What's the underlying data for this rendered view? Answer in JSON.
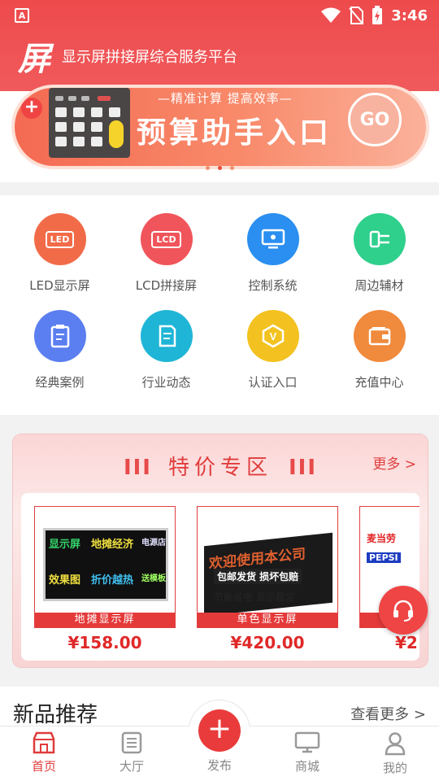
{
  "status_bar": {
    "app_badge": "A",
    "time": "3:46"
  },
  "header": {
    "logo_text": "屏",
    "platform_title": "显示屏拼接屏综合服务平台"
  },
  "banner": {
    "subtitle": "—精准计算 提高效率—",
    "title": "预算助手入口",
    "go_label": "GO",
    "plus": "+"
  },
  "categories": [
    {
      "label": "LED显示屏",
      "icon_text": "LED",
      "color": "#f26b48"
    },
    {
      "label": "LCD拼接屏",
      "icon_text": "LCD",
      "color": "#f0555b"
    },
    {
      "label": "控制系统",
      "icon_text": "",
      "color": "#2a8ff0"
    },
    {
      "label": "周边辅材",
      "icon_text": "",
      "color": "#2fcf8c"
    },
    {
      "label": "经典案例",
      "icon_text": "",
      "color": "#5b7ff0"
    },
    {
      "label": "行业动态",
      "icon_text": "",
      "color": "#1fb5d6"
    },
    {
      "label": "认证入口",
      "icon_text": "V",
      "color": "#f3c220"
    },
    {
      "label": "充值中心",
      "icon_text": "",
      "color": "#f08a3c"
    }
  ],
  "special": {
    "title": "特价专区",
    "bars": "III",
    "more_label": "更多 >",
    "products": [
      {
        "caption": "地摊显示屏",
        "price": "¥158.00",
        "screen_lines": [
          "显示屏",
          "地摊经济",
          "电源店",
          "效果图",
          "折价越热",
          "送模板"
        ]
      },
      {
        "caption": "单色显示屏",
        "price": "¥420.00",
        "screen_lines": [
          "欢迎使用本公司",
          "包邮发货 损坏包赔",
          "节能省电 显示稳定"
        ]
      },
      {
        "caption": "",
        "price": "¥2",
        "screen_lines": [
          "麦当劳",
          "PEPSI"
        ]
      }
    ]
  },
  "new_products": {
    "title": "新品推荐",
    "more_label": "查看更多 >"
  },
  "tabbar": {
    "home": "首页",
    "hall": "大厅",
    "publish": "发布",
    "mall": "商城",
    "mine": "我的",
    "publish_plus": "+"
  },
  "colors": {
    "brand_red": "#ee4a4c",
    "active_tab": "#e03c3c",
    "price_red": "#e02828"
  }
}
